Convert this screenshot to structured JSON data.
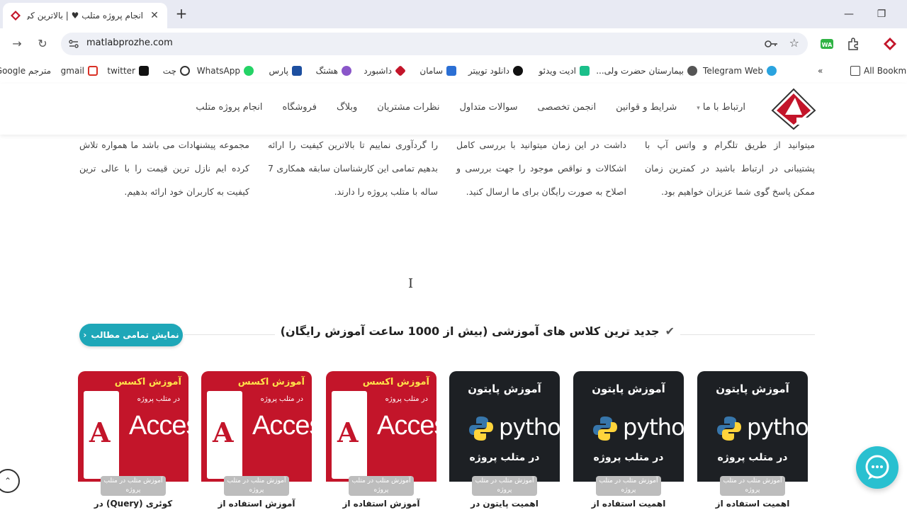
{
  "browser": {
    "tab_title": "انجام پروژه متلب ♥ | بالاترین کی...",
    "url": "matlabprozhe.com",
    "bookmarks": [
      {
        "label": "Telegram Web",
        "icon": "telegram-icon",
        "color": "#2aa3df"
      },
      {
        "label": "بیمارستان حضرت ولی...",
        "icon": "hospital-icon",
        "color": "#555555"
      },
      {
        "label": "ادیت ویدئو",
        "icon": "video-edit-icon",
        "color": "#1bbf8a"
      },
      {
        "label": "دانلود توییتر",
        "icon": "twitter-download-icon",
        "color": "#111111"
      },
      {
        "label": "سامان",
        "icon": "saman-icon",
        "color": "#2b6fd4"
      },
      {
        "label": "داشبورد",
        "icon": "dashboard-icon",
        "color": "#c3152a"
      },
      {
        "label": "هشتگ",
        "icon": "hashtag-icon",
        "color": "#8a56c9"
      },
      {
        "label": "پارس",
        "icon": "pars-icon",
        "color": "#1d4fa0"
      },
      {
        "label": "WhatsApp",
        "icon": "whatsapp-icon",
        "color": "#25d366"
      },
      {
        "label": "چت",
        "icon": "chat-icon",
        "color": "#333333"
      },
      {
        "label": "twitter",
        "icon": "x-icon",
        "color": "#111111"
      },
      {
        "label": "gmail",
        "icon": "gmail-icon",
        "color": "#d93025"
      },
      {
        "label": "مترجم Google",
        "icon": "translate-icon",
        "color": "#4285f4"
      }
    ],
    "all_bookmarks": "All Bookma"
  },
  "site": {
    "menu": [
      {
        "label": "انجام پروژه متلب"
      },
      {
        "label": "فروشگاه"
      },
      {
        "label": "وبلاگ"
      },
      {
        "label": "نظرات مشتریان"
      },
      {
        "label": "سوالات متداول"
      },
      {
        "label": "انجمن تخصصی"
      },
      {
        "label": "شرایط و قوانین"
      },
      {
        "label": "ارتباط با ما"
      }
    ],
    "features": [
      "میتوانید از طریق تلگرام و واتس آپ با پشتیبانی در ارتباط باشید در کمترین زمان ممکن پاسخ گوی شما عزیزان خواهیم بود.",
      "داشت در این زمان میتوانید با بررسی کامل اشکالات و نواقص موجود را جهت بررسی و اصلاح به صورت رایگان برای ما ارسال کنید.",
      "را گردآوری نماییم تا بالاترین کیفیت را ارائه بدهیم تمامی این کارشناسان سابقه همکاری 7 ساله با متلب پروژه را دارند.",
      "مجموعه پیشنهادات می باشد ما همواره تلاش کرده ایم نازل ترین قیمت را با عالی ترین کیفیت به کاربران خود ارائه بدهیم."
    ],
    "section_title": "جدید ترین کلاس های آموزشی (بیش از 1000 ساعت آموزش رایگان)",
    "show_all": "نمایش تمامی مطالب",
    "cards": [
      {
        "type": "python",
        "heading": "آموزش پایتون",
        "word": "python",
        "footer": "در متلب پروژه",
        "badge": "آموزش متلب در متلب پروژه",
        "caption": "اهمیت استفاده از"
      },
      {
        "type": "python",
        "heading": "آموزش پایتون",
        "word": "python",
        "footer": "در متلب پروژه",
        "badge": "آموزش متلب در متلب پروژه",
        "caption": "اهمیت استفاده از"
      },
      {
        "type": "python",
        "heading": "آموزش پایتون",
        "word": "python",
        "footer": "در متلب پروژه",
        "badge": "آموزش متلب در متلب پروژه",
        "caption": "اهمیت پایتون در"
      },
      {
        "type": "access",
        "heading": "آموزش اکسس",
        "sub": "در متلب پروژه",
        "word": "Access",
        "badge": "آموزش متلب در متلب پروژه",
        "caption": "آموزش استفاده از"
      },
      {
        "type": "access",
        "heading": "آموزش اکسس",
        "sub": "در متلب پروژه",
        "word": "Access",
        "badge": "آموزش متلب در متلب پروژه",
        "caption": "آموزش استفاده از"
      },
      {
        "type": "access",
        "heading": "آموزش اکسس",
        "sub": "در متلب پروژه",
        "word": "Access",
        "badge": "آموزش متلب در متلب پروژه",
        "caption": "کوئری (Query) در"
      }
    ]
  },
  "colors": {
    "accent": "#1ea7b8",
    "brand_red": "#c3152a",
    "chat": "#29c0d0"
  }
}
